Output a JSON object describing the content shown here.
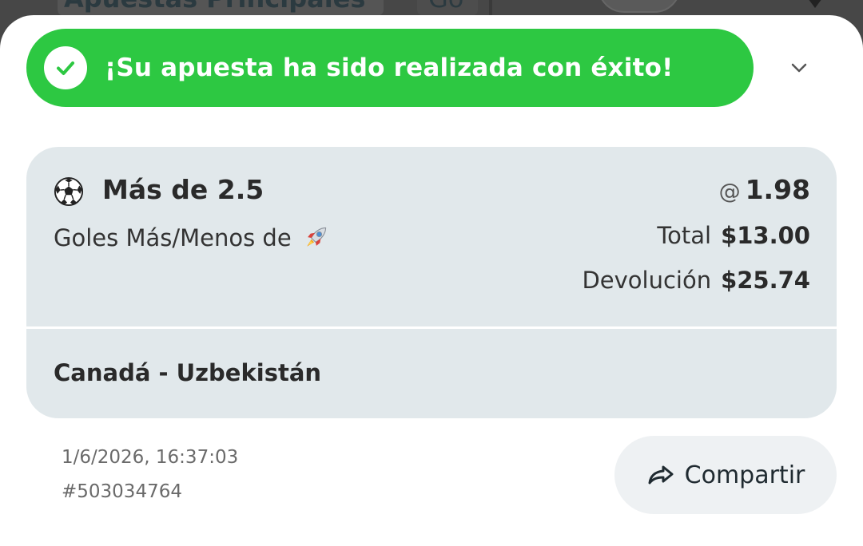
{
  "background": {
    "tab_main": "Apuestas Principales",
    "tab_secondary": "Go"
  },
  "banner": {
    "message": "¡Su apuesta ha sido realizada con éxito!",
    "icon": "check-icon",
    "color": "#2dc842"
  },
  "collapse": {
    "icon": "chevron-down-icon"
  },
  "bet": {
    "sport_icon": "soccer-ball-icon",
    "selection": "Más de 2.5",
    "market": "Goles Más/Menos de",
    "market_icon": "rocket-icon",
    "odds_prefix": "@",
    "odds": "1.98",
    "total_label": "Total",
    "total_value": "$13.00",
    "return_label": "Devolución",
    "return_value": "$25.74",
    "event": "Canadá - Uzbekistán"
  },
  "meta": {
    "timestamp": "1/6/2026, 16:37:03",
    "bet_id": "#503034764"
  },
  "share": {
    "label": "Compartir",
    "icon": "share-arrow-icon"
  }
}
